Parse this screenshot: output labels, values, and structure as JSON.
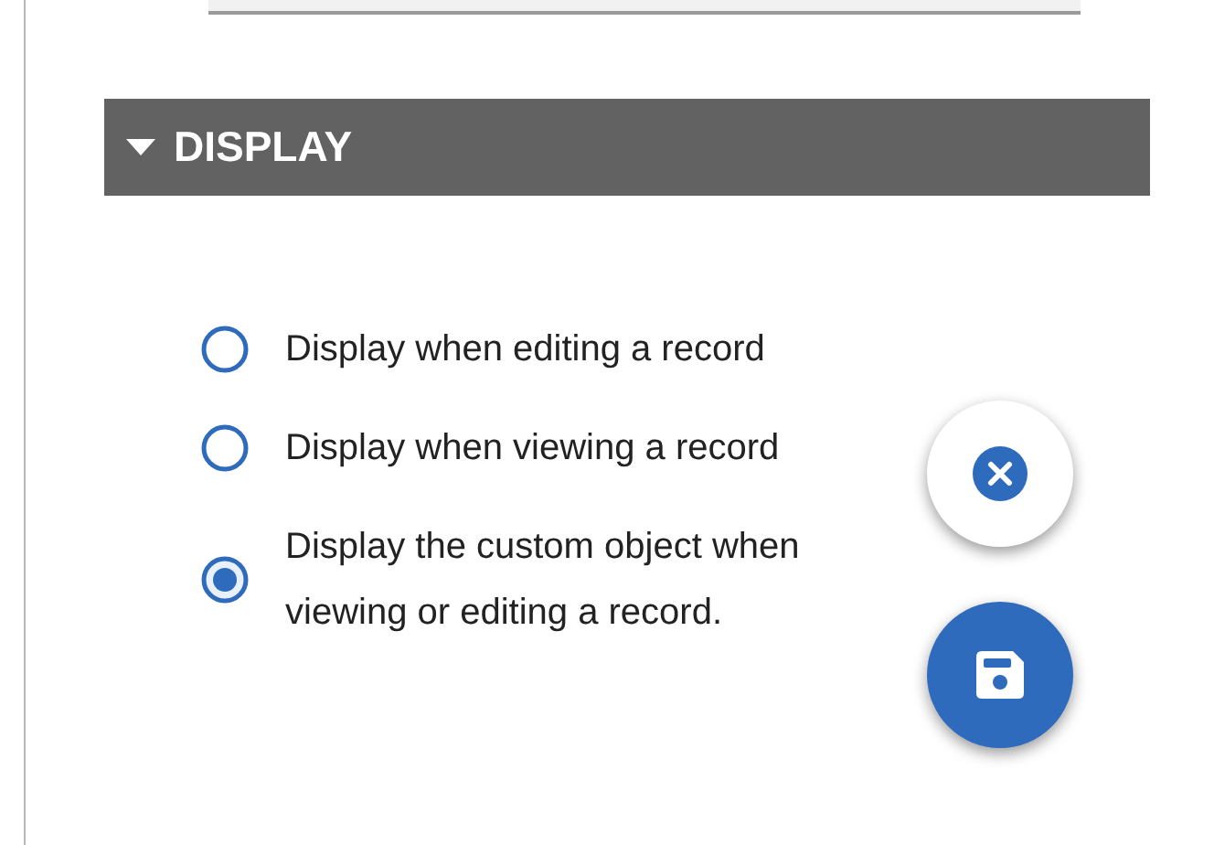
{
  "section": {
    "title": "DISPLAY",
    "expanded": true
  },
  "options": [
    {
      "label": "Display when editing a record",
      "selected": false
    },
    {
      "label": "Display when viewing a record",
      "selected": false
    },
    {
      "label": "Display the custom object when viewing or editing a record.",
      "selected": true
    }
  ],
  "actions": [
    {
      "kind": "cancel"
    },
    {
      "kind": "save"
    }
  ]
}
